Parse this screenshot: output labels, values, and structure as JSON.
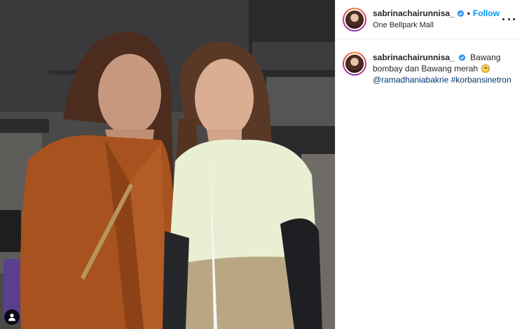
{
  "post": {
    "username": "sabrinachairunnisa_",
    "location": "One Bellpark Mall",
    "follow_label": "Follow",
    "separator": "•",
    "caption_text": "Bawang bombay dan Bawang merah",
    "caption_emoji": "grinning-sweat-emoji",
    "mention": "@ramadhaniabakrie",
    "hashtag": "#korbansinetron"
  },
  "colors": {
    "accent_blue": "#0095f6",
    "link_blue": "#00376b",
    "text": "#262626",
    "divider": "#efefef"
  },
  "icons": {
    "verified": "verified-badge-icon",
    "more": "more-options-icon",
    "user_tags": "user-tag-icon"
  }
}
